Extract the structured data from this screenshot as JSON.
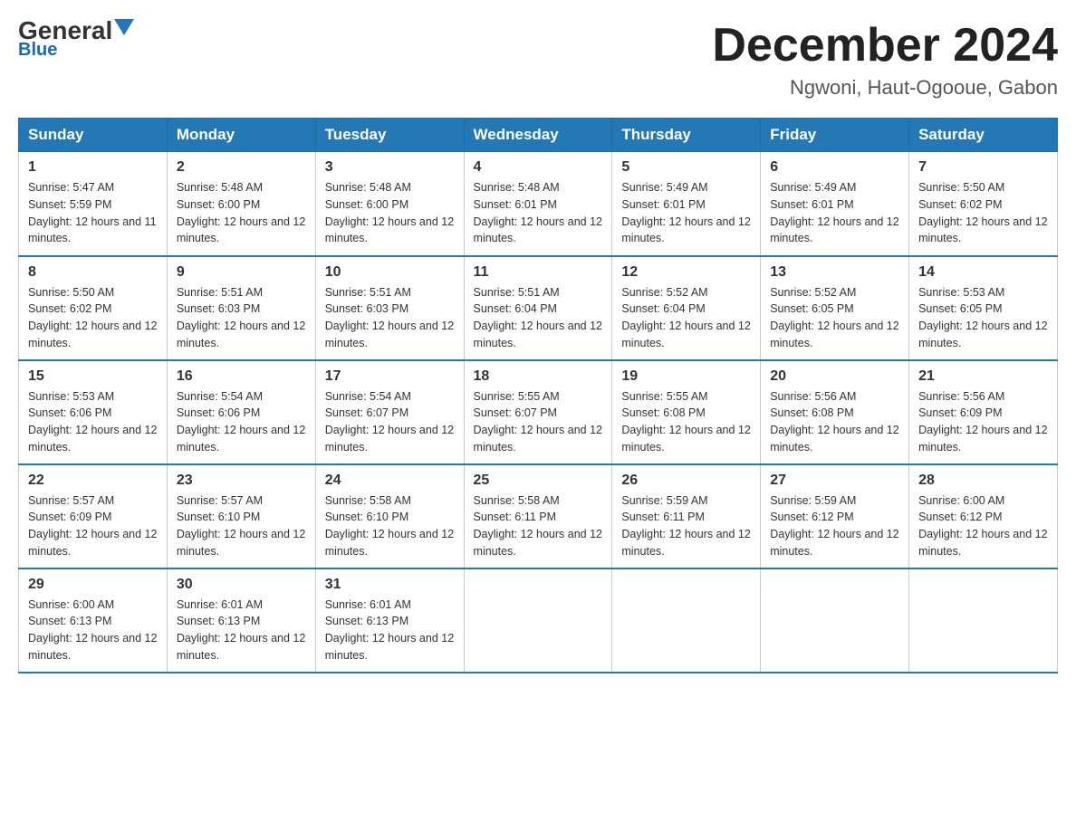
{
  "logo": {
    "general": "General",
    "blue": "Blue"
  },
  "title": "December 2024",
  "location": "Ngwoni, Haut-Ogooue, Gabon",
  "headers": [
    "Sunday",
    "Monday",
    "Tuesday",
    "Wednesday",
    "Thursday",
    "Friday",
    "Saturday"
  ],
  "weeks": [
    [
      {
        "day": "1",
        "sunrise": "5:47 AM",
        "sunset": "5:59 PM",
        "daylight": "12 hours and 11 minutes."
      },
      {
        "day": "2",
        "sunrise": "5:48 AM",
        "sunset": "6:00 PM",
        "daylight": "12 hours and 12 minutes."
      },
      {
        "day": "3",
        "sunrise": "5:48 AM",
        "sunset": "6:00 PM",
        "daylight": "12 hours and 12 minutes."
      },
      {
        "day": "4",
        "sunrise": "5:48 AM",
        "sunset": "6:01 PM",
        "daylight": "12 hours and 12 minutes."
      },
      {
        "day": "5",
        "sunrise": "5:49 AM",
        "sunset": "6:01 PM",
        "daylight": "12 hours and 12 minutes."
      },
      {
        "day": "6",
        "sunrise": "5:49 AM",
        "sunset": "6:01 PM",
        "daylight": "12 hours and 12 minutes."
      },
      {
        "day": "7",
        "sunrise": "5:50 AM",
        "sunset": "6:02 PM",
        "daylight": "12 hours and 12 minutes."
      }
    ],
    [
      {
        "day": "8",
        "sunrise": "5:50 AM",
        "sunset": "6:02 PM",
        "daylight": "12 hours and 12 minutes."
      },
      {
        "day": "9",
        "sunrise": "5:51 AM",
        "sunset": "6:03 PM",
        "daylight": "12 hours and 12 minutes."
      },
      {
        "day": "10",
        "sunrise": "5:51 AM",
        "sunset": "6:03 PM",
        "daylight": "12 hours and 12 minutes."
      },
      {
        "day": "11",
        "sunrise": "5:51 AM",
        "sunset": "6:04 PM",
        "daylight": "12 hours and 12 minutes."
      },
      {
        "day": "12",
        "sunrise": "5:52 AM",
        "sunset": "6:04 PM",
        "daylight": "12 hours and 12 minutes."
      },
      {
        "day": "13",
        "sunrise": "5:52 AM",
        "sunset": "6:05 PM",
        "daylight": "12 hours and 12 minutes."
      },
      {
        "day": "14",
        "sunrise": "5:53 AM",
        "sunset": "6:05 PM",
        "daylight": "12 hours and 12 minutes."
      }
    ],
    [
      {
        "day": "15",
        "sunrise": "5:53 AM",
        "sunset": "6:06 PM",
        "daylight": "12 hours and 12 minutes."
      },
      {
        "day": "16",
        "sunrise": "5:54 AM",
        "sunset": "6:06 PM",
        "daylight": "12 hours and 12 minutes."
      },
      {
        "day": "17",
        "sunrise": "5:54 AM",
        "sunset": "6:07 PM",
        "daylight": "12 hours and 12 minutes."
      },
      {
        "day": "18",
        "sunrise": "5:55 AM",
        "sunset": "6:07 PM",
        "daylight": "12 hours and 12 minutes."
      },
      {
        "day": "19",
        "sunrise": "5:55 AM",
        "sunset": "6:08 PM",
        "daylight": "12 hours and 12 minutes."
      },
      {
        "day": "20",
        "sunrise": "5:56 AM",
        "sunset": "6:08 PM",
        "daylight": "12 hours and 12 minutes."
      },
      {
        "day": "21",
        "sunrise": "5:56 AM",
        "sunset": "6:09 PM",
        "daylight": "12 hours and 12 minutes."
      }
    ],
    [
      {
        "day": "22",
        "sunrise": "5:57 AM",
        "sunset": "6:09 PM",
        "daylight": "12 hours and 12 minutes."
      },
      {
        "day": "23",
        "sunrise": "5:57 AM",
        "sunset": "6:10 PM",
        "daylight": "12 hours and 12 minutes."
      },
      {
        "day": "24",
        "sunrise": "5:58 AM",
        "sunset": "6:10 PM",
        "daylight": "12 hours and 12 minutes."
      },
      {
        "day": "25",
        "sunrise": "5:58 AM",
        "sunset": "6:11 PM",
        "daylight": "12 hours and 12 minutes."
      },
      {
        "day": "26",
        "sunrise": "5:59 AM",
        "sunset": "6:11 PM",
        "daylight": "12 hours and 12 minutes."
      },
      {
        "day": "27",
        "sunrise": "5:59 AM",
        "sunset": "6:12 PM",
        "daylight": "12 hours and 12 minutes."
      },
      {
        "day": "28",
        "sunrise": "6:00 AM",
        "sunset": "6:12 PM",
        "daylight": "12 hours and 12 minutes."
      }
    ],
    [
      {
        "day": "29",
        "sunrise": "6:00 AM",
        "sunset": "6:13 PM",
        "daylight": "12 hours and 12 minutes."
      },
      {
        "day": "30",
        "sunrise": "6:01 AM",
        "sunset": "6:13 PM",
        "daylight": "12 hours and 12 minutes."
      },
      {
        "day": "31",
        "sunrise": "6:01 AM",
        "sunset": "6:13 PM",
        "daylight": "12 hours and 12 minutes."
      },
      null,
      null,
      null,
      null
    ]
  ]
}
